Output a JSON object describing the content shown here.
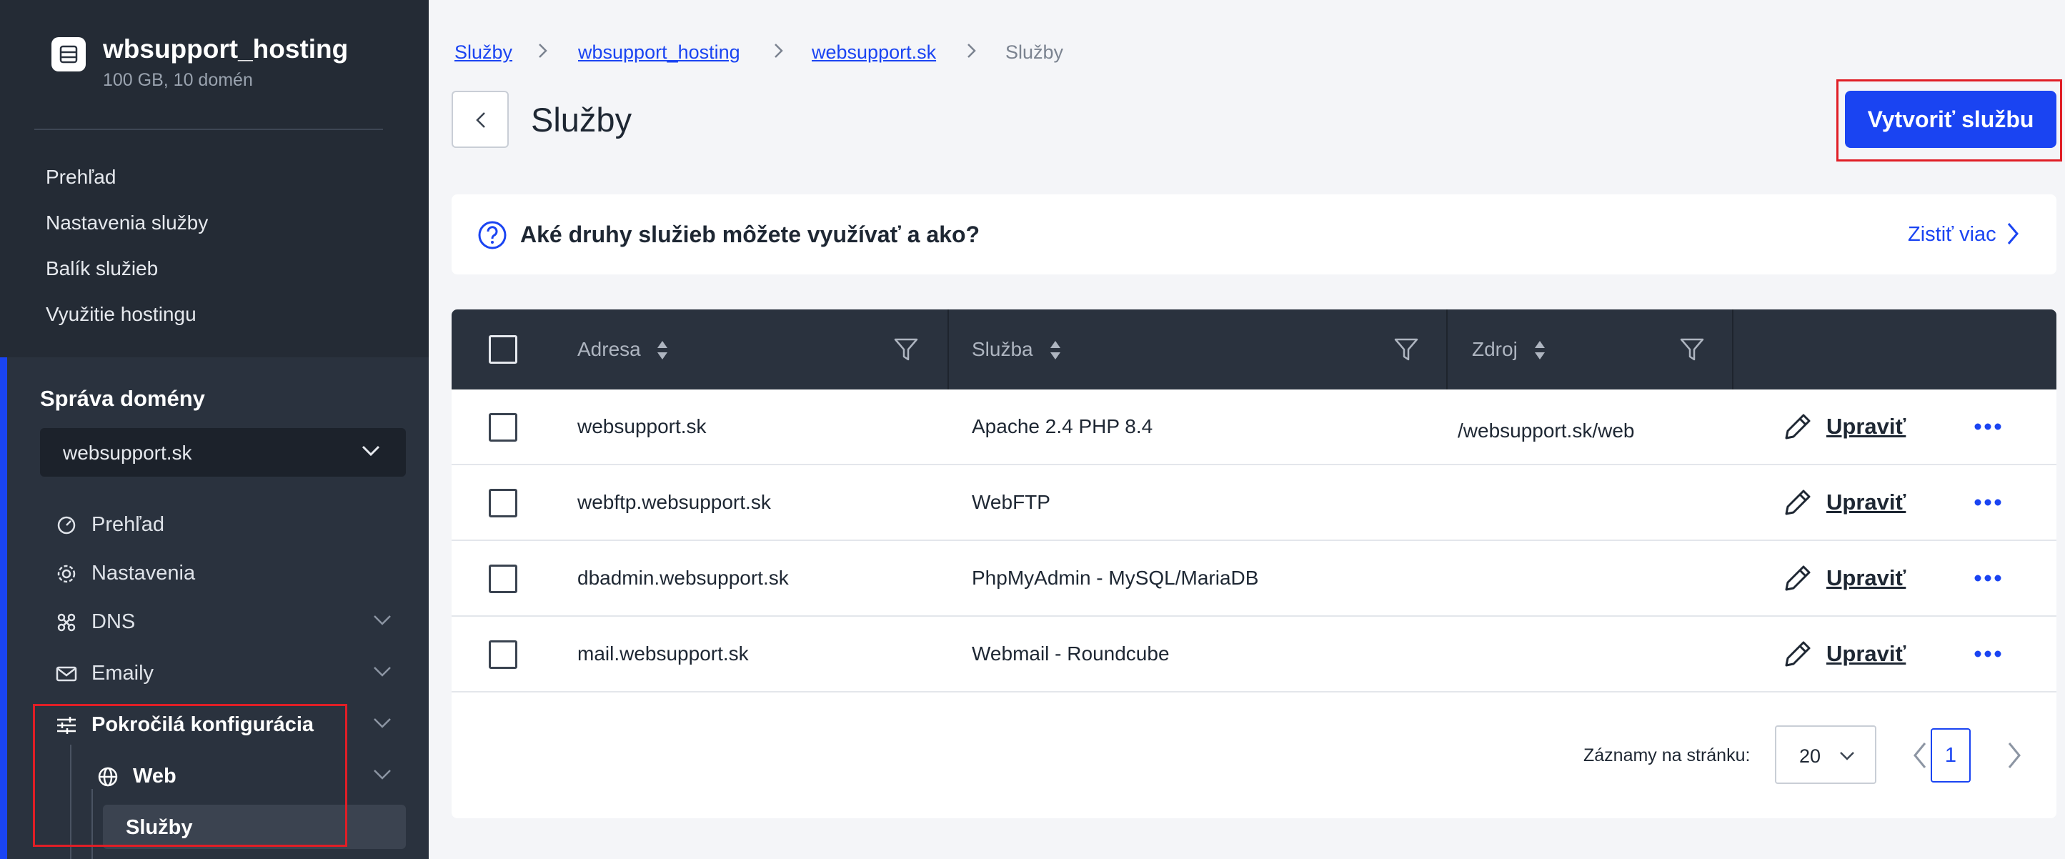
{
  "sidebar": {
    "hosting": {
      "title": "wbsupport_hosting",
      "subtitle": "100 GB, 10 domén"
    },
    "top_nav": [
      "Prehľad",
      "Nastavenia služby",
      "Balík služieb",
      "Využitie hostingu"
    ],
    "domain_section": {
      "heading": "Správa domény",
      "selected_domain": "websupport.sk",
      "items": [
        {
          "label": "Prehľad",
          "icon": "gauge-icon"
        },
        {
          "label": "Nastavenia",
          "icon": "gear-icon"
        },
        {
          "label": "DNS",
          "icon": "dns-icon"
        },
        {
          "label": "Emaily",
          "icon": "mail-icon"
        },
        {
          "label": "Pokročilá konfigurácia",
          "icon": "sliders-icon"
        }
      ],
      "sub_item": {
        "label": "Web",
        "icon": "globe-icon"
      },
      "active_item": "Služby"
    }
  },
  "breadcrumb": [
    "Služby",
    "wbsupport_hosting",
    "websupport.sk",
    "Služby"
  ],
  "page": {
    "title": "Služby",
    "create_button": "Vytvoriť službu"
  },
  "info": {
    "text": "Aké druhy služieb môžete využívať a ako?",
    "link": "Zistiť viac"
  },
  "table": {
    "columns": [
      "Adresa",
      "Služba",
      "Zdroj"
    ],
    "rows": [
      {
        "address": "websupport.sk",
        "service": "Apache 2.4 PHP 8.4",
        "source": "/websupport.sk/web",
        "action": "Upraviť"
      },
      {
        "address": "webftp.websupport.sk",
        "service": "WebFTP",
        "source": "",
        "action": "Upraviť"
      },
      {
        "address": "dbadmin.websupport.sk",
        "service": "PhpMyAdmin - MySQL/MariaDB",
        "source": "",
        "action": "Upraviť"
      },
      {
        "address": "mail.websupport.sk",
        "service": "Webmail - Roundcube",
        "source": "",
        "action": "Upraviť"
      }
    ]
  },
  "pagination": {
    "label": "Záznamy na stránku:",
    "per_page": "20",
    "current_page": "1"
  },
  "colors": {
    "accent": "#1a44f2",
    "sidebar": "#2a323e",
    "highlight": "#e01e26"
  }
}
